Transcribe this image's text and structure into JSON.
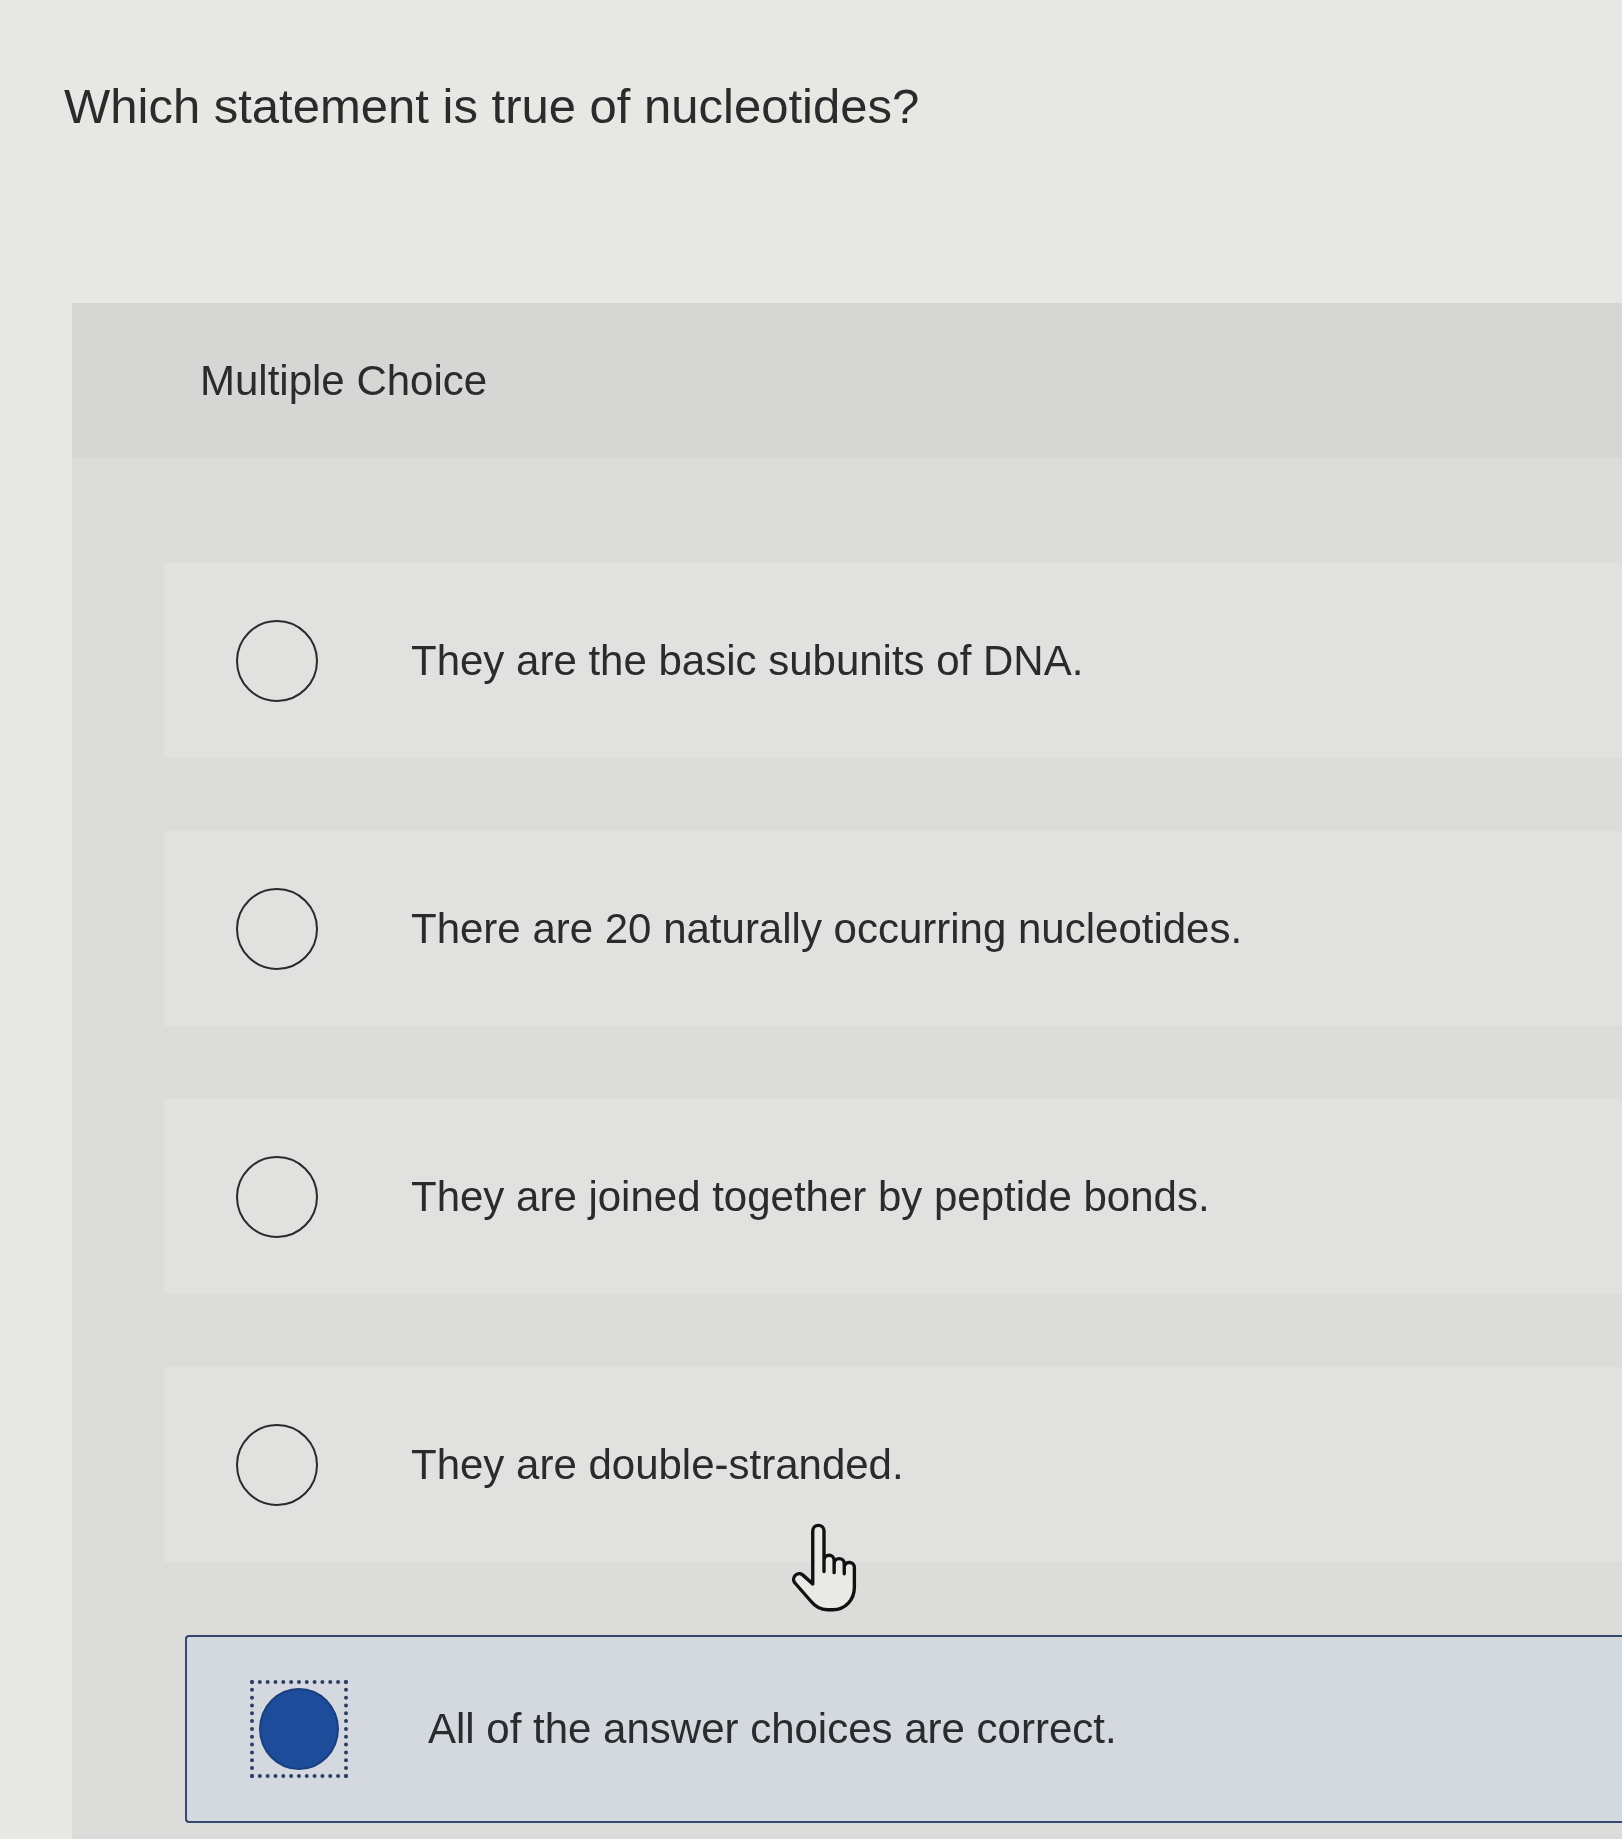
{
  "question": "Which statement is true of nucleotides?",
  "panel": {
    "heading": "Multiple Choice",
    "options": [
      {
        "text": "They are the basic subunits of DNA.",
        "selected": false,
        "focused": false
      },
      {
        "text": "There are 20 naturally occurring nucleotides.",
        "selected": false,
        "focused": false
      },
      {
        "text": "They are joined together by peptide bonds.",
        "selected": false,
        "focused": false
      },
      {
        "text": "They are double-stranded.",
        "selected": false,
        "focused": false
      },
      {
        "text": "All of the answer choices are correct.",
        "selected": true,
        "focused": true
      }
    ]
  }
}
